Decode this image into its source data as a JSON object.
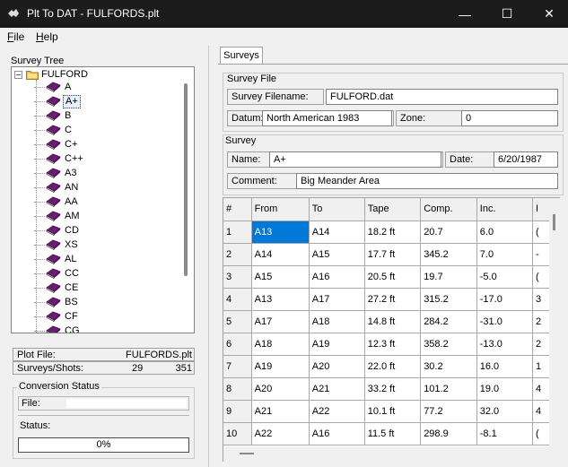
{
  "window": {
    "title": "Plt To DAT - FULFORDS.plt",
    "minimize_glyph": "—",
    "maximize_glyph": "☐",
    "close_glyph": "✕"
  },
  "menu": {
    "file": {
      "accel": "F",
      "rest": "ile"
    },
    "help": {
      "accel": "H",
      "rest": "elp"
    }
  },
  "tree": {
    "label": "Survey Tree",
    "root_expander": "−",
    "root": "FULFORD",
    "items": [
      "A",
      "A+",
      "B",
      "C",
      "C+",
      "C++",
      "A3",
      "AN",
      "AA",
      "AM",
      "CD",
      "XS",
      "AL",
      "CC",
      "CE",
      "BS",
      "CF",
      "CG"
    ],
    "selected": "A+"
  },
  "info": {
    "plot_file_label": "Plot File:",
    "plot_file_value": "FULFORDS.plt",
    "surveys_shots_label": "Surveys/Shots:",
    "surveys_count": "29",
    "shots_count": "351"
  },
  "conversion": {
    "title": "Conversion Status",
    "file_label": "File:",
    "status_label": "Status:",
    "progress_text": "0%",
    "progress_fraction": 0
  },
  "tabs": [
    "Surveys"
  ],
  "survey_file": {
    "title": "Survey File",
    "filename_label": "Survey Filename:",
    "filename_value": "FULFORD.dat",
    "datum_label": "Datum:",
    "datum_value": "North American 1983",
    "zone_label": "Zone:",
    "zone_value": "0"
  },
  "survey": {
    "title": "Survey",
    "name_label": "Name:",
    "name_value": "A+",
    "date_label": "Date:",
    "date_value": "6/20/1987",
    "comment_label": "Comment:",
    "comment_value": "Big Meander Area"
  },
  "grid": {
    "headers": [
      "#",
      "From",
      "To",
      "Tape",
      "Comp.",
      "Inc.",
      "I"
    ],
    "rows": [
      {
        "n": "1",
        "from": "A13",
        "to": "A14",
        "tape": "18.2 ft",
        "comp": "20.7",
        "inc": "6.0",
        "extra": "("
      },
      {
        "n": "2",
        "from": "A14",
        "to": "A15",
        "tape": "17.7 ft",
        "comp": "345.2",
        "inc": "7.0",
        "extra": "-"
      },
      {
        "n": "3",
        "from": "A15",
        "to": "A16",
        "tape": "20.5 ft",
        "comp": "19.7",
        "inc": "-5.0",
        "extra": "("
      },
      {
        "n": "4",
        "from": "A13",
        "to": "A17",
        "tape": "27.2 ft",
        "comp": "315.2",
        "inc": "-17.0",
        "extra": "3"
      },
      {
        "n": "5",
        "from": "A17",
        "to": "A18",
        "tape": "14.8 ft",
        "comp": "284.2",
        "inc": "-31.0",
        "extra": "2"
      },
      {
        "n": "6",
        "from": "A18",
        "to": "A19",
        "tape": "12.3 ft",
        "comp": "358.2",
        "inc": "-13.0",
        "extra": "2"
      },
      {
        "n": "7",
        "from": "A19",
        "to": "A20",
        "tape": "22.0 ft",
        "comp": "30.2",
        "inc": "16.0",
        "extra": "1"
      },
      {
        "n": "8",
        "from": "A20",
        "to": "A21",
        "tape": "33.2 ft",
        "comp": "101.2",
        "inc": "19.0",
        "extra": "4"
      },
      {
        "n": "9",
        "from": "A21",
        "to": "A22",
        "tape": "10.1 ft",
        "comp": "77.2",
        "inc": "32.0",
        "extra": "4"
      },
      {
        "n": "10",
        "from": "A22",
        "to": "A16",
        "tape": "11.5 ft",
        "comp": "298.9",
        "inc": "-8.1",
        "extra": "("
      }
    ]
  },
  "colors": {
    "titlebar": "#1c1c1c",
    "selection": "#0078d7",
    "book": "#6b1f73"
  },
  "icons": [
    "app-icon",
    "folder-icon",
    "book-icon",
    "minimize-icon",
    "maximize-icon",
    "close-icon"
  ]
}
